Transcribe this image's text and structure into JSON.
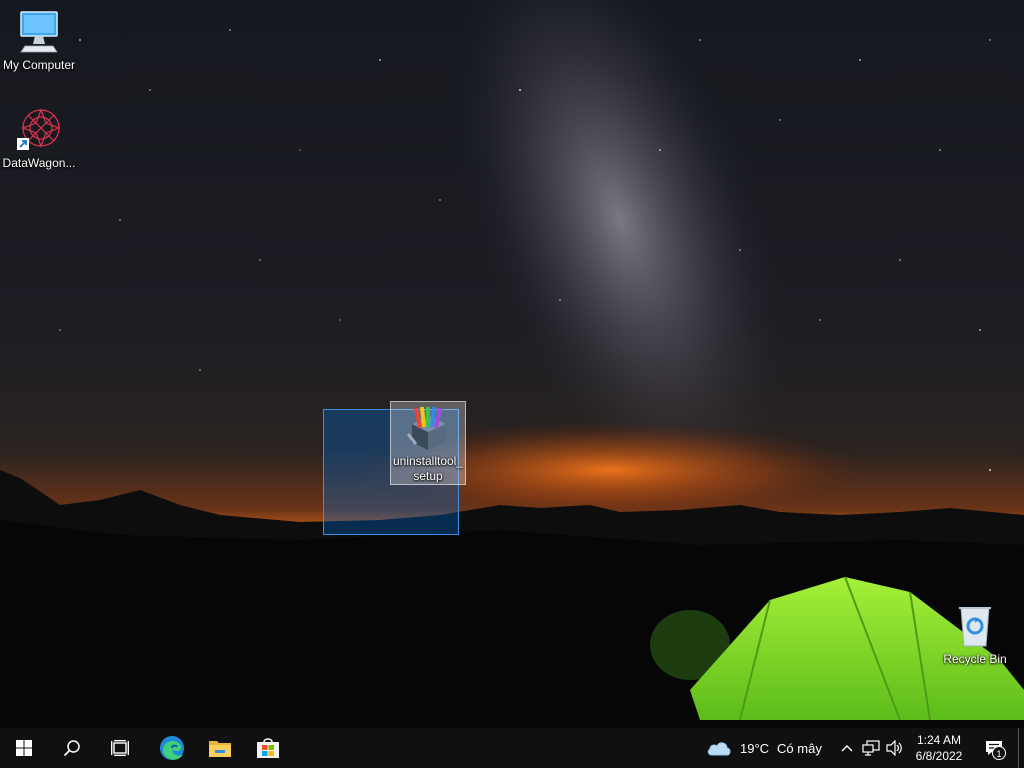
{
  "desktop": {
    "icons": [
      {
        "label": "My Computer",
        "icon": "monitor-icon"
      },
      {
        "label": "DataWagon...",
        "icon": "datawagon-icon"
      },
      {
        "label": "uninstalltool_ setup",
        "icon": "archive-cabinet-icon"
      },
      {
        "label": "Recycle Bin",
        "icon": "recycle-bin-icon"
      }
    ]
  },
  "taskbar": {
    "start": "windows-logo-icon",
    "search": "search-icon",
    "task_view": "task-view-icon",
    "pinned": [
      {
        "app": "Microsoft Edge",
        "icon": "edge-icon"
      },
      {
        "app": "File Explorer",
        "icon": "folder-icon"
      },
      {
        "app": "Microsoft Store",
        "icon": "store-icon"
      }
    ],
    "weather": {
      "temperature": "19°C",
      "condition": "Có mây",
      "icon": "cloud-icon"
    },
    "clock": {
      "time": "1:24 AM",
      "date": "6/8/2022"
    },
    "notifications": {
      "count": "1",
      "icon": "action-center-icon"
    }
  },
  "colors": {
    "taskbar_bg": "#101010",
    "selection": "#0066cc",
    "tent_green": "#7dd62a",
    "horizon_glow": "#d9641a"
  }
}
